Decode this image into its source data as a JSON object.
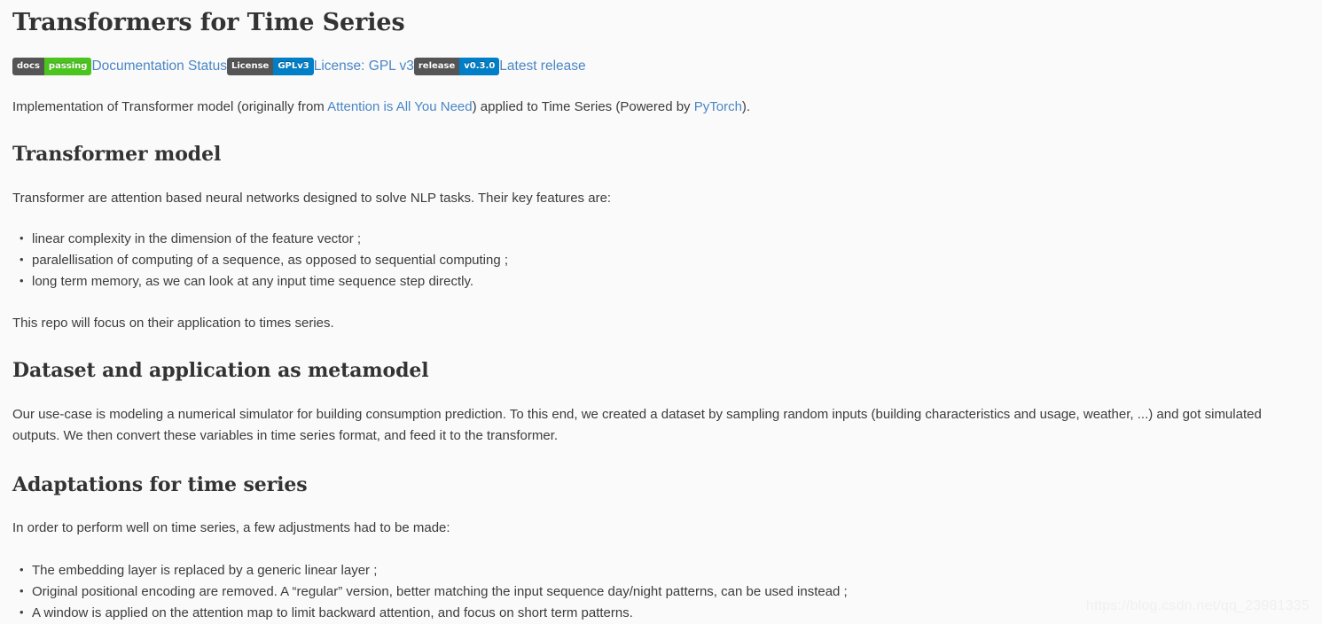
{
  "document": {
    "title": "Transformers for Time Series"
  },
  "badges": [
    {
      "id": "docs-badge",
      "left_label": "docs",
      "right_label": "passing",
      "right_color": "#4bc51d",
      "left_color": "#555555",
      "link_text": "Documentation Status"
    },
    {
      "id": "license-badge",
      "left_label": "License",
      "right_label": "GPLv3",
      "right_color": "#007ec6",
      "left_color": "#555555",
      "link_text": "License: GPL v3"
    },
    {
      "id": "release-badge",
      "left_label": "release",
      "right_label": "v0.3.0",
      "right_color": "#007ec6",
      "left_color": "#555555",
      "link_text": "Latest release"
    }
  ],
  "intro": {
    "part1": "Implementation of Transformer model (originally from ",
    "link1": "Attention is All You Need",
    "part2": ") applied to Time Series (Powered by ",
    "link2": "PyTorch",
    "part3": ")."
  },
  "sections": [
    {
      "id": "transformer-model",
      "heading": "Transformer model",
      "paragraph": "Transformer are attention based neural networks designed to solve NLP tasks. Their key features are:",
      "bullets": [
        "linear complexity in the dimension of the feature vector ;",
        "paralellisation of computing of a sequence, as opposed to sequential computing ;",
        "long term memory, as we can look at any input time sequence step directly."
      ],
      "closing": "This repo will focus on their application to times series."
    },
    {
      "id": "dataset-and-application",
      "heading": "Dataset and application as metamodel",
      "paragraph": "Our use-case is modeling a numerical simulator for building consumption prediction. To this end, we created a dataset by sampling random inputs (building characteristics and usage, weather, ...) and got simulated outputs. We then convert these variables in time series format, and feed it to the transformer."
    },
    {
      "id": "adaptations-for-time-series",
      "heading": "Adaptations for time series",
      "paragraph": "In order to perform well on time series, a few adjustments had to be made:",
      "bullets": [
        "The embedding layer is replaced by a generic linear layer ;",
        "Original positional encoding are removed. A “regular” version, better matching the input sequence day/night patterns, can be used instead ;",
        "A window is applied on the attention map to limit backward attention, and focus on short term patterns."
      ]
    }
  ],
  "watermark": {
    "text": "https://blog.csdn.net/qq_23981335"
  },
  "colors": {
    "page_background": "#fafafa",
    "body_text": "#3c3c3c",
    "heading_text": "#333333",
    "link": "#4a86c5",
    "badge_gray": "#555555",
    "badge_green": "#4bc51d",
    "badge_blue": "#007ec6",
    "watermark": "#f0f0f0"
  }
}
